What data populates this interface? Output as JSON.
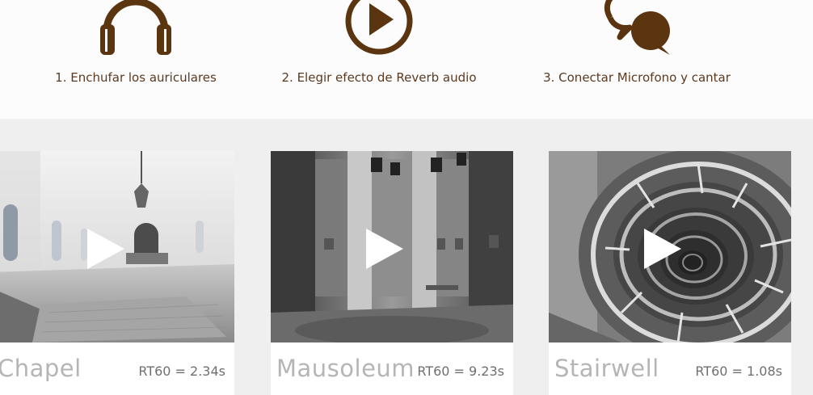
{
  "steps": [
    {
      "icon": "headphones-icon",
      "label": "1. Enchufar los auriculares"
    },
    {
      "icon": "play-circle-icon",
      "label": "2. Elegir efecto de Reverb audio"
    },
    {
      "icon": "chat-bubbles-icon",
      "label": "3. Conectar Microfono y cantar"
    }
  ],
  "cards": [
    {
      "name": "Chapel",
      "rt60": "RT60 = 2.34s"
    },
    {
      "name": "Mausoleum",
      "rt60": "RT60 = 9.23s"
    },
    {
      "name": "Stairwell",
      "rt60": "RT60 = 1.08s"
    }
  ],
  "colors": {
    "accent": "#5b3410",
    "label": "#5b3a20",
    "gallery_bg": "#efefef"
  }
}
